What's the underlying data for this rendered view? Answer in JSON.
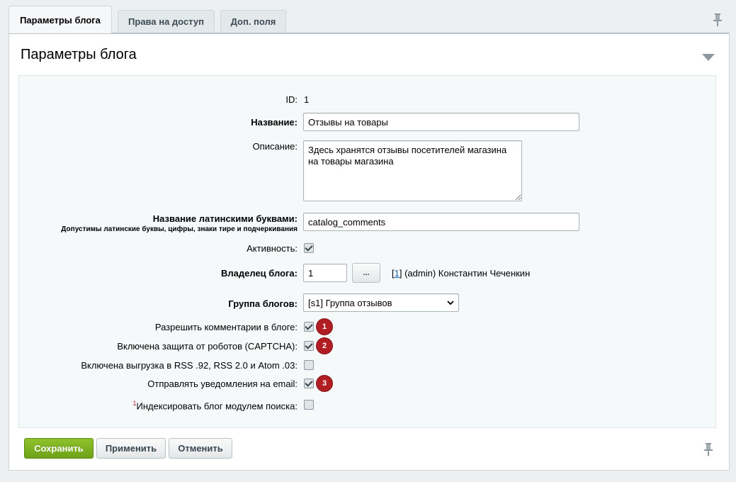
{
  "tabs": [
    {
      "label": "Параметры блога"
    },
    {
      "label": "Права на доступ"
    },
    {
      "label": "Доп. поля"
    }
  ],
  "panel": {
    "title": "Параметры блога"
  },
  "form": {
    "id_label": "ID:",
    "id_value": "1",
    "name_label": "Название:",
    "name_value": "Отзывы на товары",
    "description_label": "Описание:",
    "description_value": "Здесь хранятся отзывы посетителей магазина на товары магазина",
    "latin_label": "Название латинскими буквами:",
    "latin_hint": "Допустимы латинские буквы, цифры, знаки тире и подчеркивания",
    "latin_value": "catalog_comments",
    "active_label": "Активность:",
    "active_checked": true,
    "owner_label": "Владелец блога:",
    "owner_value": "1",
    "owner_browse": "...",
    "owner_link_id": "1",
    "owner_text": "(admin) Константин Чеченкин",
    "group_label": "Группа блогов:",
    "group_value": "[s1] Группа отзывов",
    "comments_label": "Разрешить комментарии в блоге:",
    "comments_checked": true,
    "captcha_label": "Включена защита от роботов (CAPTCHA):",
    "captcha_checked": true,
    "rss_label": "Включена выгрузка в RSS .92, RSS 2.0 и Atom .03:",
    "rss_checked": false,
    "email_label": "Отправлять уведомления на email:",
    "email_checked": true,
    "index_sup": "1",
    "index_label": "Индексировать блог модулем поиска:",
    "index_checked": false
  },
  "badges": [
    "1",
    "2",
    "3"
  ],
  "buttons": {
    "save": "Сохранить",
    "apply": "Применить",
    "cancel": "Отменить"
  },
  "colors": {
    "save_button": "#7bb21f",
    "badge": "#b01e23",
    "link": "#2067b0"
  },
  "icons": {
    "pin": "pin-icon",
    "collapse": "chevron-down-icon"
  }
}
